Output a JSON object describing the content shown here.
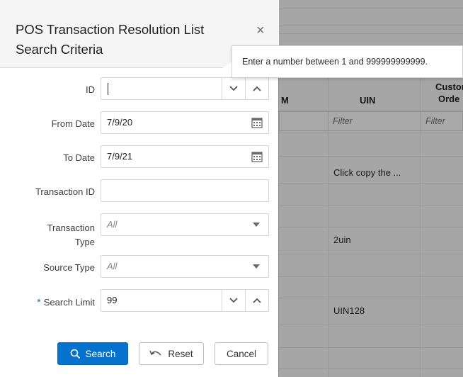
{
  "dialog": {
    "title": "POS Transaction Resolution List Search Criteria",
    "close_icon": "×",
    "fields": {
      "id": {
        "label": "ID",
        "value": "",
        "down_icon": "⌄",
        "up_icon": "⌃"
      },
      "from_date": {
        "label": "From Date",
        "value": "7/9/20"
      },
      "to_date": {
        "label": "To Date",
        "value": "7/9/21"
      },
      "transaction_id": {
        "label": "Transaction ID",
        "value": ""
      },
      "transaction_type": {
        "label_line1": "Transaction",
        "label_line2": "Type",
        "value": "All"
      },
      "source_type": {
        "label": "Source Type",
        "value": "All"
      },
      "search_limit": {
        "required_marker": "*",
        "label": "Search Limit",
        "value": "99"
      }
    },
    "buttons": {
      "search": "Search",
      "reset": "Reset",
      "cancel": "Cancel"
    }
  },
  "tooltip": {
    "text": "Enter a number between 1 and 999999999999."
  },
  "background_table": {
    "headers": {
      "col_partial": "M",
      "uin": "UIN",
      "customer_line1": "Custor",
      "customer_line2": "Orde"
    },
    "filter_placeholder": "Filter",
    "cells": [
      "Click copy the ...",
      "2uin",
      "UIN128"
    ]
  },
  "colors": {
    "primary_button": "#0572ce",
    "required_marker": "#0572ce",
    "overlay": "#a6a6a6"
  }
}
